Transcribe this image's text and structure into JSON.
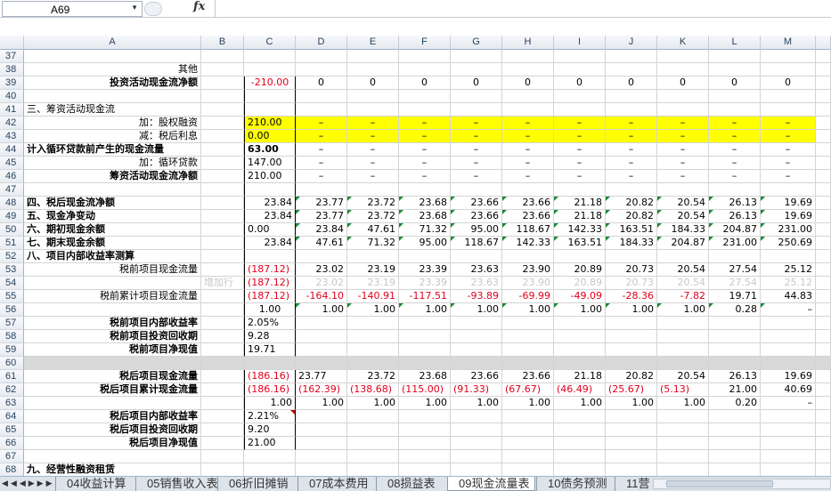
{
  "formula_bar": {
    "name_box": "A69",
    "fx_label": "fx"
  },
  "columns": [
    "A",
    "B",
    "C",
    "D",
    "E",
    "F",
    "G",
    "H",
    "I",
    "J",
    "K",
    "L",
    "M"
  ],
  "rows": [
    {
      "n": "37",
      "cells": {}
    },
    {
      "n": "38",
      "cells": {
        "A": {
          "v": "其他",
          "cls": "r"
        }
      }
    },
    {
      "n": "39",
      "cells": {
        "A": {
          "v": "投资活动现金流净额",
          "cls": "r bold"
        },
        "C": {
          "v": "-210.00",
          "cls": "red ctr"
        },
        "D": {
          "v": "0",
          "cls": "ctr"
        },
        "E": {
          "v": "0",
          "cls": "ctr"
        },
        "F": {
          "v": "0",
          "cls": "ctr"
        },
        "G": {
          "v": "0",
          "cls": "ctr"
        },
        "H": {
          "v": "0",
          "cls": "ctr"
        },
        "I": {
          "v": "0",
          "cls": "ctr"
        },
        "J": {
          "v": "0",
          "cls": "ctr"
        },
        "K": {
          "v": "0",
          "cls": "ctr"
        },
        "L": {
          "v": "0",
          "cls": "ctr"
        },
        "M": {
          "v": "0",
          "cls": "ctr"
        }
      }
    },
    {
      "n": "40",
      "cells": {}
    },
    {
      "n": "41",
      "cells": {
        "A": {
          "v": "三、筹资活动现金流",
          "cls": ""
        }
      }
    },
    {
      "n": "42",
      "yellow": true,
      "cells": {
        "A": {
          "v": "加：股权融资",
          "cls": "r"
        },
        "C": {
          "v": "210.00",
          "cls": ""
        },
        "D": {
          "v": "–",
          "cls": "ctr"
        },
        "E": {
          "v": "–",
          "cls": "ctr"
        },
        "F": {
          "v": "–",
          "cls": "ctr"
        },
        "G": {
          "v": "–",
          "cls": "ctr"
        },
        "H": {
          "v": "–",
          "cls": "ctr"
        },
        "I": {
          "v": "–",
          "cls": "ctr"
        },
        "J": {
          "v": "–",
          "cls": "ctr"
        },
        "K": {
          "v": "–",
          "cls": "ctr"
        },
        "L": {
          "v": "–",
          "cls": "ctr"
        },
        "M": {
          "v": "–",
          "cls": "ctr"
        }
      }
    },
    {
      "n": "43",
      "yellow": true,
      "cells": {
        "A": {
          "v": "减：税后利息",
          "cls": "r"
        },
        "C": {
          "v": "0.00",
          "cls": ""
        },
        "D": {
          "v": "–",
          "cls": "ctr"
        },
        "E": {
          "v": "–",
          "cls": "ctr"
        },
        "F": {
          "v": "–",
          "cls": "ctr"
        },
        "G": {
          "v": "–",
          "cls": "ctr"
        },
        "H": {
          "v": "–",
          "cls": "ctr"
        },
        "I": {
          "v": "–",
          "cls": "ctr"
        },
        "J": {
          "v": "–",
          "cls": "ctr"
        },
        "K": {
          "v": "–",
          "cls": "ctr"
        },
        "L": {
          "v": "–",
          "cls": "ctr"
        },
        "M": {
          "v": "–",
          "cls": "ctr"
        }
      }
    },
    {
      "n": "44",
      "cells": {
        "A": {
          "v": "计入循环贷款前产生的现金流量",
          "cls": "bold"
        },
        "C": {
          "v": "63.00",
          "cls": "bold"
        },
        "D": {
          "v": "–",
          "cls": "ctr"
        },
        "E": {
          "v": "–",
          "cls": "ctr"
        },
        "F": {
          "v": "–",
          "cls": "ctr"
        },
        "G": {
          "v": "–",
          "cls": "ctr"
        },
        "H": {
          "v": "–",
          "cls": "ctr"
        },
        "I": {
          "v": "–",
          "cls": "ctr"
        },
        "J": {
          "v": "–",
          "cls": "ctr"
        },
        "K": {
          "v": "–",
          "cls": "ctr"
        },
        "L": {
          "v": "–",
          "cls": "ctr"
        },
        "M": {
          "v": "–",
          "cls": "ctr"
        }
      }
    },
    {
      "n": "45",
      "cells": {
        "A": {
          "v": "加：循环贷款",
          "cls": "r"
        },
        "C": {
          "v": "147.00",
          "cls": ""
        },
        "D": {
          "v": "–",
          "cls": "ctr"
        },
        "E": {
          "v": "–",
          "cls": "ctr"
        },
        "F": {
          "v": "–",
          "cls": "ctr"
        },
        "G": {
          "v": "–",
          "cls": "ctr"
        },
        "H": {
          "v": "–",
          "cls": "ctr"
        },
        "I": {
          "v": "–",
          "cls": "ctr"
        },
        "J": {
          "v": "–",
          "cls": "ctr"
        },
        "K": {
          "v": "–",
          "cls": "ctr"
        },
        "L": {
          "v": "–",
          "cls": "ctr"
        },
        "M": {
          "v": "–",
          "cls": "ctr"
        }
      }
    },
    {
      "n": "46",
      "cells": {
        "A": {
          "v": "筹资活动现金流净额",
          "cls": "r bold"
        },
        "C": {
          "v": "210.00",
          "cls": ""
        },
        "D": {
          "v": "–",
          "cls": "ctr"
        },
        "E": {
          "v": "–",
          "cls": "ctr"
        },
        "F": {
          "v": "–",
          "cls": "ctr"
        },
        "G": {
          "v": "–",
          "cls": "ctr"
        },
        "H": {
          "v": "–",
          "cls": "ctr"
        },
        "I": {
          "v": "–",
          "cls": "ctr"
        },
        "J": {
          "v": "–",
          "cls": "ctr"
        },
        "K": {
          "v": "–",
          "cls": "ctr"
        },
        "L": {
          "v": "–",
          "cls": "ctr"
        },
        "M": {
          "v": "–",
          "cls": "ctr"
        }
      }
    },
    {
      "n": "47",
      "cells": {}
    },
    {
      "n": "48",
      "cells": {
        "A": {
          "v": "四、税后现金流净额",
          "cls": "bold"
        },
        "C": {
          "v": "23.84",
          "cls": "r"
        },
        "D": {
          "v": "23.77",
          "cls": "r tri"
        },
        "E": {
          "v": "23.72",
          "cls": "r tri"
        },
        "F": {
          "v": "23.68",
          "cls": "r tri"
        },
        "G": {
          "v": "23.66",
          "cls": "r tri"
        },
        "H": {
          "v": "23.66",
          "cls": "r tri"
        },
        "I": {
          "v": "21.18",
          "cls": "r tri"
        },
        "J": {
          "v": "20.82",
          "cls": "r tri"
        },
        "K": {
          "v": "20.54",
          "cls": "r tri"
        },
        "L": {
          "v": "26.13",
          "cls": "r tri"
        },
        "M": {
          "v": "19.69",
          "cls": "r tri"
        }
      }
    },
    {
      "n": "49",
      "cells": {
        "A": {
          "v": "五、现金净变动",
          "cls": "bold"
        },
        "C": {
          "v": "23.84",
          "cls": "r"
        },
        "D": {
          "v": "23.77",
          "cls": "r tri"
        },
        "E": {
          "v": "23.72",
          "cls": "r tri"
        },
        "F": {
          "v": "23.68",
          "cls": "r tri"
        },
        "G": {
          "v": "23.66",
          "cls": "r tri"
        },
        "H": {
          "v": "23.66",
          "cls": "r tri"
        },
        "I": {
          "v": "21.18",
          "cls": "r tri"
        },
        "J": {
          "v": "20.82",
          "cls": "r tri"
        },
        "K": {
          "v": "20.54",
          "cls": "r tri"
        },
        "L": {
          "v": "26.13",
          "cls": "r tri"
        },
        "M": {
          "v": "19.69",
          "cls": "r tri"
        }
      }
    },
    {
      "n": "50",
      "cells": {
        "A": {
          "v": "六、期初现金余额",
          "cls": "bold"
        },
        "C": {
          "v": "0.00",
          "cls": ""
        },
        "D": {
          "v": "23.84",
          "cls": "r tri"
        },
        "E": {
          "v": "47.61",
          "cls": "r tri"
        },
        "F": {
          "v": "71.32",
          "cls": "r tri"
        },
        "G": {
          "v": "95.00",
          "cls": "r tri"
        },
        "H": {
          "v": "118.67",
          "cls": "r tri"
        },
        "I": {
          "v": "142.33",
          "cls": "r tri"
        },
        "J": {
          "v": "163.51",
          "cls": "r tri"
        },
        "K": {
          "v": "184.33",
          "cls": "r tri"
        },
        "L": {
          "v": "204.87",
          "cls": "r tri"
        },
        "M": {
          "v": "231.00",
          "cls": "r tri"
        }
      }
    },
    {
      "n": "51",
      "cells": {
        "A": {
          "v": "七、期末现金余额",
          "cls": "bold"
        },
        "C": {
          "v": "23.84",
          "cls": "r"
        },
        "D": {
          "v": "47.61",
          "cls": "r tri"
        },
        "E": {
          "v": "71.32",
          "cls": "r tri"
        },
        "F": {
          "v": "95.00",
          "cls": "r tri"
        },
        "G": {
          "v": "118.67",
          "cls": "r tri"
        },
        "H": {
          "v": "142.33",
          "cls": "r tri"
        },
        "I": {
          "v": "163.51",
          "cls": "r tri"
        },
        "J": {
          "v": "184.33",
          "cls": "r tri"
        },
        "K": {
          "v": "204.87",
          "cls": "r tri"
        },
        "L": {
          "v": "231.00",
          "cls": "r tri"
        },
        "M": {
          "v": "250.69",
          "cls": "r tri"
        }
      }
    },
    {
      "n": "52",
      "cells": {
        "A": {
          "v": "八、项目内部收益率测算",
          "cls": "bold"
        }
      }
    },
    {
      "n": "53",
      "cells": {
        "A": {
          "v": "税前项目现金流量",
          "cls": "r"
        },
        "C": {
          "v": "(187.12)",
          "cls": "red"
        },
        "D": {
          "v": "23.02",
          "cls": "r"
        },
        "E": {
          "v": "23.19",
          "cls": "r"
        },
        "F": {
          "v": "23.39",
          "cls": "r"
        },
        "G": {
          "v": "23.63",
          "cls": "r"
        },
        "H": {
          "v": "23.90",
          "cls": "r"
        },
        "I": {
          "v": "20.89",
          "cls": "r"
        },
        "J": {
          "v": "20.73",
          "cls": "r"
        },
        "K": {
          "v": "20.54",
          "cls": "r"
        },
        "L": {
          "v": "27.54",
          "cls": "r"
        },
        "M": {
          "v": "25.12",
          "cls": "r"
        }
      }
    },
    {
      "n": "54",
      "cells": {
        "B": {
          "v": "增加行",
          "cls": "gray"
        },
        "C": {
          "v": "(187.12)",
          "cls": "red"
        },
        "D": {
          "v": "23.02",
          "cls": "r gray"
        },
        "E": {
          "v": "23.19",
          "cls": "r gray"
        },
        "F": {
          "v": "23.39",
          "cls": "r gray"
        },
        "G": {
          "v": "23.63",
          "cls": "r gray"
        },
        "H": {
          "v": "23.90",
          "cls": "r gray"
        },
        "I": {
          "v": "20.89",
          "cls": "r gray"
        },
        "J": {
          "v": "20.73",
          "cls": "r gray"
        },
        "K": {
          "v": "20.54",
          "cls": "r gray"
        },
        "L": {
          "v": "27.54",
          "cls": "r gray"
        },
        "M": {
          "v": "25.12",
          "cls": "r gray"
        }
      }
    },
    {
      "n": "55",
      "cells": {
        "A": {
          "v": "税前累计项目现金流量",
          "cls": "r"
        },
        "C": {
          "v": "(187.12)",
          "cls": "red"
        },
        "D": {
          "v": "-164.10",
          "cls": "r red"
        },
        "E": {
          "v": "-140.91",
          "cls": "r red"
        },
        "F": {
          "v": "-117.51",
          "cls": "r red"
        },
        "G": {
          "v": "-93.89",
          "cls": "r red"
        },
        "H": {
          "v": "-69.99",
          "cls": "r red"
        },
        "I": {
          "v": "-49.09",
          "cls": "r red"
        },
        "J": {
          "v": "-28.36",
          "cls": "r red"
        },
        "K": {
          "v": "-7.82",
          "cls": "r red"
        },
        "L": {
          "v": "19.71",
          "cls": "r"
        },
        "M": {
          "v": "44.83",
          "cls": "r"
        }
      }
    },
    {
      "n": "56",
      "cells": {
        "C": {
          "v": "1.00",
          "cls": "ctr"
        },
        "D": {
          "v": "1.00",
          "cls": "r tri"
        },
        "E": {
          "v": "1.00",
          "cls": "r tri"
        },
        "F": {
          "v": "1.00",
          "cls": "r tri"
        },
        "G": {
          "v": "1.00",
          "cls": "r tri"
        },
        "H": {
          "v": "1.00",
          "cls": "r tri"
        },
        "I": {
          "v": "1.00",
          "cls": "r tri"
        },
        "J": {
          "v": "1.00",
          "cls": "r tri"
        },
        "K": {
          "v": "1.00",
          "cls": "r tri"
        },
        "L": {
          "v": "0.28",
          "cls": "r tri"
        },
        "M": {
          "v": "–",
          "cls": "r tri"
        }
      }
    },
    {
      "n": "57",
      "cells": {
        "A": {
          "v": "税前项目内部收益率",
          "cls": "r bold"
        },
        "C": {
          "v": "2.05%",
          "cls": ""
        }
      }
    },
    {
      "n": "58",
      "cells": {
        "A": {
          "v": "税前项目投资回收期",
          "cls": "r bold"
        },
        "C": {
          "v": "9.28",
          "cls": ""
        }
      }
    },
    {
      "n": "59",
      "cells": {
        "A": {
          "v": "税前项目净现值",
          "cls": "r bold"
        },
        "C": {
          "v": "19.71",
          "cls": ""
        }
      }
    },
    {
      "n": "60",
      "band": true,
      "cells": {}
    },
    {
      "n": "61",
      "cells": {
        "A": {
          "v": "税后项目现金流量",
          "cls": "r bold"
        },
        "C": {
          "v": "(186.16)",
          "cls": "red"
        },
        "D": {
          "v": "23.77",
          "cls": ""
        },
        "E": {
          "v": "23.72",
          "cls": "r"
        },
        "F": {
          "v": "23.68",
          "cls": "r"
        },
        "G": {
          "v": "23.66",
          "cls": "r"
        },
        "H": {
          "v": "23.66",
          "cls": "r"
        },
        "I": {
          "v": "21.18",
          "cls": "r"
        },
        "J": {
          "v": "20.82",
          "cls": "r"
        },
        "K": {
          "v": "20.54",
          "cls": "r"
        },
        "L": {
          "v": "26.13",
          "cls": "r"
        },
        "M": {
          "v": "19.69",
          "cls": "r"
        }
      }
    },
    {
      "n": "62",
      "cells": {
        "A": {
          "v": "税后项目累计现金流量",
          "cls": "r bold"
        },
        "C": {
          "v": "(186.16)",
          "cls": "red"
        },
        "D": {
          "v": "(162.39)",
          "cls": "red"
        },
        "E": {
          "v": "(138.68)",
          "cls": "red"
        },
        "F": {
          "v": "(115.00)",
          "cls": "red"
        },
        "G": {
          "v": "(91.33)",
          "cls": "red"
        },
        "H": {
          "v": "(67.67)",
          "cls": "red"
        },
        "I": {
          "v": "(46.49)",
          "cls": "red"
        },
        "J": {
          "v": "(25.67)",
          "cls": "red"
        },
        "K": {
          "v": "(5.13)",
          "cls": "red"
        },
        "L": {
          "v": "21.00",
          "cls": "r"
        },
        "M": {
          "v": "40.69",
          "cls": "r"
        }
      }
    },
    {
      "n": "63",
      "cells": {
        "C": {
          "v": "1.00",
          "cls": "r"
        },
        "D": {
          "v": "1.00",
          "cls": "r"
        },
        "E": {
          "v": "1.00",
          "cls": "r"
        },
        "F": {
          "v": "1.00",
          "cls": "r"
        },
        "G": {
          "v": "1.00",
          "cls": "r"
        },
        "H": {
          "v": "1.00",
          "cls": "r"
        },
        "I": {
          "v": "1.00",
          "cls": "r"
        },
        "J": {
          "v": "1.00",
          "cls": "r"
        },
        "K": {
          "v": "1.00",
          "cls": "r"
        },
        "L": {
          "v": "0.20",
          "cls": "r"
        },
        "M": {
          "v": "–",
          "cls": "r"
        }
      }
    },
    {
      "n": "64",
      "cells": {
        "A": {
          "v": "税后项目内部收益率",
          "cls": "r bold"
        },
        "C": {
          "v": "2.21%",
          "cls": "tri2"
        }
      }
    },
    {
      "n": "65",
      "cells": {
        "A": {
          "v": "税后项目投资回收期",
          "cls": "r bold"
        },
        "C": {
          "v": "9.20",
          "cls": ""
        }
      }
    },
    {
      "n": "66",
      "cells": {
        "A": {
          "v": "税后项目净现值",
          "cls": "r bold"
        },
        "C": {
          "v": "21.00",
          "cls": ""
        }
      }
    },
    {
      "n": "67",
      "cells": {}
    },
    {
      "n": "68",
      "cells": {
        "A": {
          "v": "九、经营性融资租赁",
          "cls": "bold"
        }
      }
    }
  ],
  "sheet_tabs": [
    "04收益计算",
    "05销售收入表",
    "06折旧摊销",
    "07成本费用",
    "08损益表",
    "09现金流量表",
    "10债务预测",
    "11营"
  ],
  "active_tab": "09现金流量表"
}
